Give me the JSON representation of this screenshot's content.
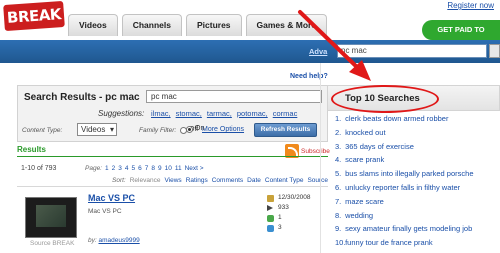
{
  "header": {
    "logo_text": "BREAK",
    "register_link": "Register now",
    "tabs": [
      "Videos",
      "Channels",
      "Pictures",
      "Games & More"
    ],
    "upload_button": "GET PAID TO UPLOAD"
  },
  "search_bar": {
    "advanced_link": "Adva",
    "query": "pc mac"
  },
  "help_link": "Need help?",
  "search_panel": {
    "title": "Search Results - pc mac",
    "query": "pc mac",
    "suggestions_label": "Suggestions:",
    "suggestions": [
      "ilmac,",
      "stomac,",
      "tarmac,",
      "potomac,",
      "cormac"
    ],
    "content_type_label": "Content Type:",
    "content_type_value": "Videos",
    "family_filter_label": "Family Filter:",
    "filter_off": "Off",
    "filter_on": "On",
    "more_options": "More Options",
    "refresh_button": "Refresh Results"
  },
  "results": {
    "header": "Results",
    "subscribe": "Subscribe",
    "count": "1-10 of 793",
    "pager_label": "Page:",
    "pages": [
      "1",
      "2",
      "3",
      "4",
      "5",
      "6",
      "7",
      "8",
      "9",
      "10",
      "11"
    ],
    "next_label": "Next >",
    "sort_label": "Sort:",
    "sort_current": "Relevance",
    "sort_options": [
      "Views",
      "Ratings",
      "Comments",
      "Date",
      "Content Type",
      "Source"
    ],
    "item": {
      "title": "Mac VS PC",
      "description": "Mac VS PC",
      "source": "Source BREAK",
      "by_label": "by:",
      "author": "amadeus9999",
      "date": "12/30/2008",
      "views": "933",
      "thumbs": "1",
      "comments": "3"
    }
  },
  "top_searches": {
    "title": "Top 10 Searches",
    "items": [
      "clerk beats down armed robber",
      "knocked out",
      "365 days of exercise",
      "scare prank",
      "bus slams into illegally parked porsche",
      "unlucky reporter falls in filthy water",
      "maze scare",
      "wedding",
      "sexy amateur finally gets modeling job",
      "funny tour de france prank"
    ]
  },
  "colors": {
    "accent_blue": "#1f578f",
    "link_blue": "#1a4fa8",
    "highlight_red": "#e01818",
    "results_green": "#2a9a2a",
    "upload_green": "#2fa82f"
  },
  "icons": [
    "rss-icon",
    "calendar-icon",
    "play-icon",
    "thumbs-up-icon",
    "comment-icon"
  ]
}
